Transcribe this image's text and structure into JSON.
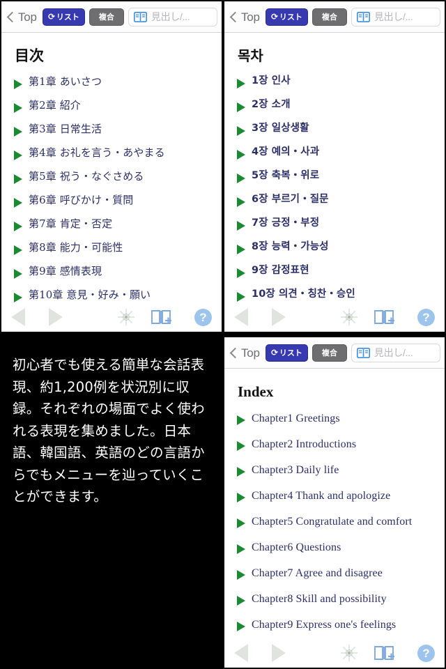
{
  "toolbar": {
    "back_label": "Top",
    "back_icon": "chevron-left-icon",
    "list_label": "リスト",
    "list_icon": "refresh-arrow-icon",
    "multi_label": "複合",
    "search_icon": "open-book-icon",
    "search_placeholder": "見出し/...",
    "list_color": "#3639b0",
    "multi_color": "#6e6e70"
  },
  "bottombar": {
    "prev_icon": "triangle-left-icon",
    "next_icon": "triangle-right-icon",
    "settings_icon": "ship-wheel-icon",
    "bookmark_icon": "book-plus-icon",
    "help_icon": "question-mark-icon",
    "help_label": "?",
    "help_color": "#9dc4ec"
  },
  "panels": {
    "japanese": {
      "title": "目次",
      "items": [
        "第1章 あいさつ",
        "第2章 紹介",
        "第3章 日常生活",
        "第4章 お礼を言う・あやまる",
        "第5章 祝う・なぐさめる",
        "第6章 呼びかけ・質問",
        "第7章 肯定・否定",
        "第8章 能力・可能性",
        "第9章 感情表現",
        "第10章 意見・好み・願い"
      ]
    },
    "korean": {
      "title": "목차",
      "items": [
        "1장 인사",
        "2장 소개",
        "3장 일상생활",
        "4장 예의・사과",
        "5장 축복・위로",
        "6장 부르기・질문",
        "7장 긍정・부정",
        "8장 능력・가능성",
        "9장 감정표현",
        "10장 의견・칭찬・승인"
      ]
    },
    "english": {
      "title": "Index",
      "items": [
        "Chapter1 Greetings",
        "Chapter2 Introductions",
        "Chapter3 Daily life",
        "Chapter4 Thank and apologize",
        "Chapter5 Congratulate and comfort",
        "Chapter6 Questions",
        "Chapter7 Agree and disagree",
        "Chapter8 Skill and possibility",
        "Chapter9 Express one's feelings"
      ]
    }
  },
  "description": {
    "text": "初心者でも使える簡単な会話表現、約1,200例を状況別に収録。それぞれの場面でよく使われる表現を集めました。日本語、韓国語、英語のどの言語からでもメニューを辿っていくことができます。"
  },
  "colors": {
    "triangle_green": "#1b8a33",
    "label_navy": "#2b2f66",
    "background": "#000000"
  }
}
